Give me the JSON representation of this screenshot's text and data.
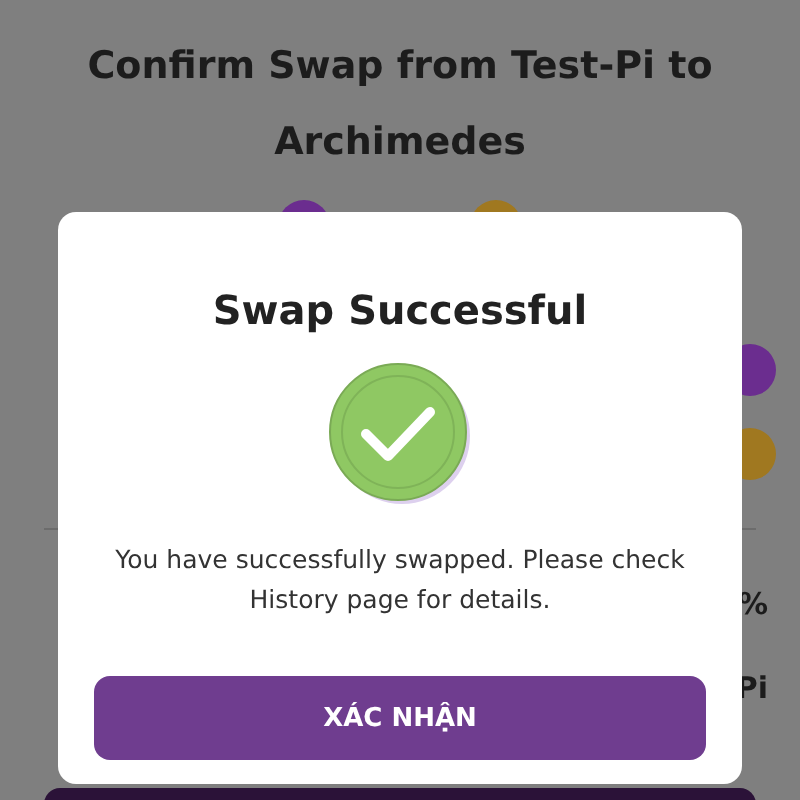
{
  "page": {
    "title": "Confirm Swap from Test-Pi to Archimedes",
    "fee_rows": [
      {
        "value": "%"
      },
      {
        "value": "Pi"
      }
    ]
  },
  "dialog": {
    "title": "Swap Successful",
    "message": "You have successfully swapped. Please check History page for details.",
    "button": "XÁC NHẬN"
  }
}
